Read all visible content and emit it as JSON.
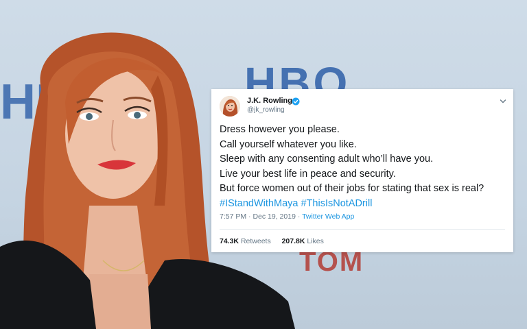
{
  "background": {
    "logo_text": "HBO",
    "logo_left_text": "HB",
    "logo_bottom_text": "TOM"
  },
  "tweet": {
    "display_name": "J.K. Rowling",
    "handle": "@jk_rowling",
    "verified_icon": "verified-badge",
    "menu_icon": "chevron-down",
    "lines": [
      "Dress however you please.",
      "Call yourself whatever you like.",
      "Sleep with any consenting adult who’ll have you.",
      "Live your best life in peace and security.",
      "But force women out of their jobs for stating that sex is real?"
    ],
    "hashtags": [
      "#IStandWithMaya",
      "#ThisIsNotADrill"
    ],
    "time": "7:57 PM",
    "date": "Dec 19, 2019",
    "source": "Twitter Web App",
    "retweets_count": "74.3K",
    "retweets_label": "Retweets",
    "likes_count": "207.8K",
    "likes_label": "Likes"
  },
  "colors": {
    "link": "#1b95e0",
    "text": "#14171a",
    "muted": "#657786",
    "verified": "#1da1f2"
  }
}
